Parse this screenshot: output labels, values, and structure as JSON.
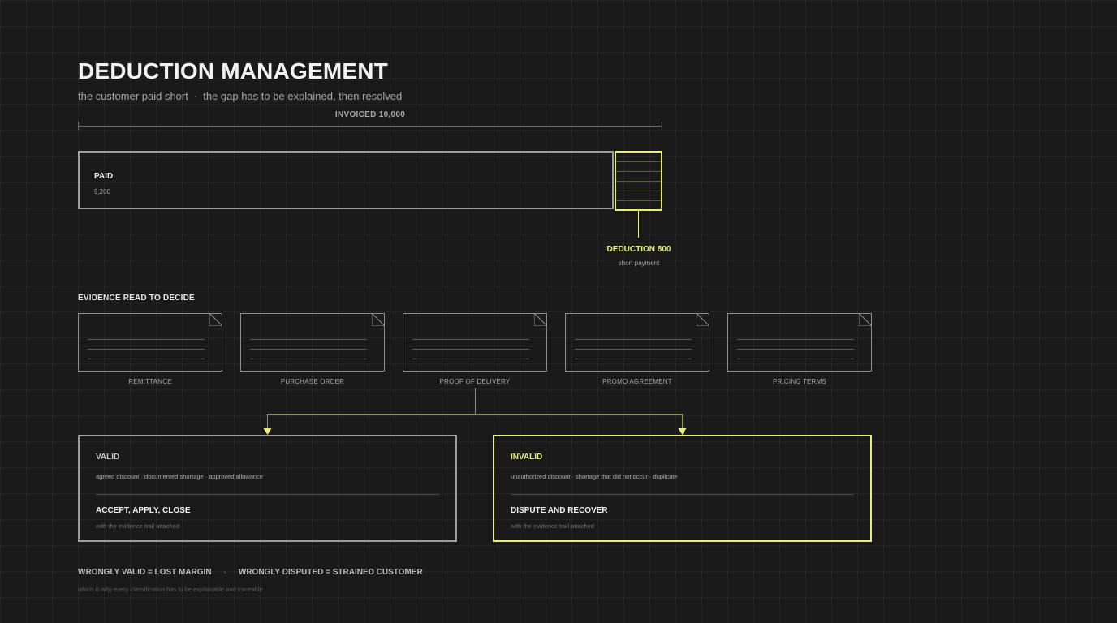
{
  "title": "DEDUCTION MANAGEMENT",
  "subtitle": {
    "part1": "the customer paid short",
    "separator": "·",
    "part2": "the gap has to be explained, then resolved"
  },
  "invoice": {
    "label": "INVOICED  10,000",
    "total": 10000
  },
  "paid": {
    "label": "PAID",
    "value": "9,200",
    "amount": 9200
  },
  "deduction": {
    "label": "DEDUCTION  800",
    "sub": "short payment",
    "amount": 800
  },
  "evidence": {
    "heading": "EVIDENCE READ TO DECIDE",
    "documents": [
      {
        "label": "REMITTANCE"
      },
      {
        "label": "PURCHASE ORDER"
      },
      {
        "label": "PROOF OF DELIVERY"
      },
      {
        "label": "PROMO AGREEMENT"
      },
      {
        "label": "PRICING TERMS"
      }
    ]
  },
  "outcomes": {
    "valid": {
      "title": "VALID",
      "list": "agreed discount · documented shortage · approved allowance",
      "action": "ACCEPT, APPLY, CLOSE",
      "note": "with the evidence trail attached"
    },
    "invalid": {
      "title": "INVALID",
      "list": "unauthorized discount · shortage that did not occur · duplicate",
      "action": "DISPUTE AND RECOVER",
      "note": "with the evidence trail attached"
    }
  },
  "footer": {
    "left": "WRONGLY VALID = LOST MARGIN",
    "separator": "·",
    "right": "WRONGLY DISPUTED = STRAINED CUSTOMER",
    "note": "which is why every classification has to be explainable and traceable"
  },
  "colors": {
    "background": "#1a1a1a",
    "accent": "#e9ef7a",
    "neutral_border": "#9e9e9e",
    "text": "#f2f2f2",
    "muted": "#a8a8a8"
  }
}
